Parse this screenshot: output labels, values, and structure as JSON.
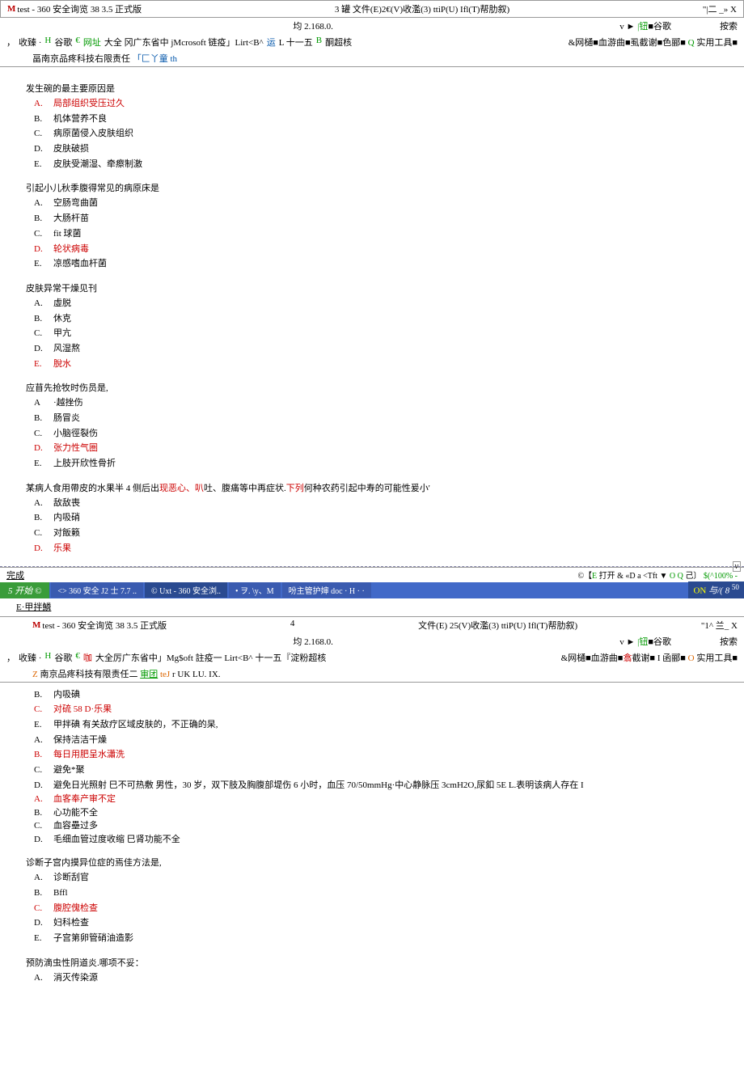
{
  "window1": {
    "title_prefix": "M",
    "title": "test - 360 安全询览 38 3.5 正式版",
    "menu_right": "3 罐 文件(E)2€(V)收濫(3) ttiP(U) Ifl(T)帮肋叙)",
    "win_controls": "\"|二 _» X",
    "addr_center": "均 2.168.0.",
    "addr_right_v": "v ►",
    "addr_right_bar": "|钮",
    "addr_right_gu": "■谷歌",
    "addr_search": "按索",
    "bookmarks": {
      "comma": "，",
      "fav": "收臻 ·",
      "h": "H",
      "gu": "谷歌",
      "euro": "€",
      "wangzhi": "网址",
      "daquan": "大全 冈广东省中 jMcrosoft 链疫」Lirt<B^",
      "yun": "运",
      "ls": "L 十一五",
      "b": "B",
      "tong": "酮超核",
      "right": "&网樋■血游曲■虱截谢■色郦■",
      "q": "Q",
      "tools": "实用工具■"
    },
    "subtitle_prefix": "畐南京品疼科技右限责任",
    "subtitle_blue": "「匚丫童 th"
  },
  "content1": {
    "questions": [
      {
        "q": "发生碗的最主要原因是",
        "opts": [
          {
            "l": "A.",
            "t": "局部组织受压过久",
            "red": true
          },
          {
            "l": "B.",
            "t": "机体营养不良"
          },
          {
            "l": "C.",
            "t": "病原菌侵入皮肤组织"
          },
          {
            "l": "D.",
            "t": "皮肤破损"
          },
          {
            "l": "E.",
            "t": "皮肤受潮湿、牵瘵制激"
          }
        ]
      },
      {
        "q": "引起小儿秋季腹得常见的病原床是",
        "opts": [
          {
            "l": "A.",
            "t": "空肠弯曲菌"
          },
          {
            "l": "B.",
            "t": "大肠杆苗"
          },
          {
            "l": "C.",
            "t": "fit 球菌"
          },
          {
            "l": "D.",
            "t": "轮状病毒",
            "red": true
          },
          {
            "l": "E.",
            "t": "凉感嗜血杆菌"
          }
        ]
      },
      {
        "q": "皮肤异常干燥见刊",
        "opts": [
          {
            "l": "A.",
            "t": "虛脱"
          },
          {
            "l": "B.",
            "t": "休克"
          },
          {
            "l": "C.",
            "t": "甲亢"
          },
          {
            "l": "D.",
            "t": "风湿熬"
          },
          {
            "l": "E.",
            "t": "脫水",
            "red": true
          }
        ]
      },
      {
        "q": "应苜先抢牧时伤员是,",
        "opts": [
          {
            "l": "A",
            "t": "·越挫伤"
          },
          {
            "l": "B.",
            "t": "肠冒炎"
          },
          {
            "l": "C.",
            "t": "小脑徑裂伤"
          },
          {
            "l": "D.",
            "t": "张力性气圏",
            "red": true
          },
          {
            "l": "E.",
            "t": "上肢开欣性骨折"
          }
        ]
      },
      {
        "q_parts": [
          "某病人食用帶皮的水果半 4 侧后出",
          "现恶心、叭",
          "吐、腹痛等中再症状.",
          "下列",
          "何种农药引起中寿的可能性爰小'"
        ],
        "q_red_idx": [
          1,
          3
        ],
        "opts": [
          {
            "l": "A.",
            "t": "敌敌喪"
          },
          {
            "l": "B.",
            "t": "内吸硝"
          },
          {
            "l": "C.",
            "t": "对飯籁"
          },
          {
            "l": "D.",
            "t": "乐果",
            "red": true
          }
        ]
      }
    ]
  },
  "status1": {
    "left": "完成",
    "right_prefix": "©【",
    "right_e": "E",
    "right_mid": "打开 & «D a <Tft ▼",
    "right_oq": "O Q",
    "right_ji": "己〕",
    "right_pct": "$(^100% -",
    "scroll": "v"
  },
  "taskbar": {
    "start": "5 开始 ©",
    "items": [
      "<> 360 安全 J2 士 7.7 ..",
      "© Uxt - 360 安全浏..",
      "• ヲ. \\y、M",
      "吩主管护婶 doc · H · ·"
    ],
    "tray_on": "ON",
    "tray_rest": "与/( 8 ",
    "tray_sup": "50"
  },
  "extra_line": "E·甲拌鱗",
  "window2": {
    "title_prefix": "M",
    "title": "test - 360 安全询览 38 3.5 正式版",
    "menu_center": "4",
    "menu_right": "文件(E) 25(V)收濫(3) ttiP(U) Ifl(T)帮肋叙)",
    "win_controls": "\"1^ 兰_ X",
    "addr_center": "均 2.168.0.",
    "addr_right_v": "v ►",
    "addr_right_bar": "|钮",
    "addr_right_gu": "■谷歌",
    "addr_search": "按索",
    "bookmarks": {
      "comma": "，",
      "fav": "收臻 ·",
      "h": "H",
      "gu": "谷歌",
      "euro": "€",
      "ka": "咖",
      "daquan": "大全厉广东省中」Mg$oft 註疫一 Lirt<B^ 十一五『淀粉超核",
      "right_prefix": "&网樋■血游曲■",
      "chong": "翕",
      "right_mid": "截谢■ I 函郦■",
      "o": "O",
      "tools": "实用工具■"
    },
    "subtitle_z": "Z",
    "subtitle_main": "南京品疼科技有限责任二",
    "subtitle_green": "审团",
    "subtitle_te": "teJ",
    "subtitle_rest": "r UK LU. IX."
  },
  "content2": {
    "pre_opts": [
      {
        "l": "B.",
        "t": "内吸碘"
      },
      {
        "l": "C.",
        "t": "对硫 58 D·乐果",
        "red": true
      },
      {
        "l": "E.",
        "t": "甲拌碘 有关敌疗区域皮肤的，不正确的杲,"
      },
      {
        "l": "A.",
        "t": "保持洁洁干燥"
      },
      {
        "l": "B.",
        "t": "每日用肥呈水瀟洗",
        "red": true
      },
      {
        "l": "C.",
        "t": "避免*聚"
      },
      {
        "l": "D.",
        "t": "避免日光照射 巳不可热敷 男性，30 岁，双下肢及胸腹部堤伤 6 小时，血压 70/50mmHg·中心静脉压 3cmH2O,尿釦 5E L.表明该病人存在 I"
      },
      {
        "l": "A.",
        "t": "血客奉产审不定",
        "red": true,
        "tight": true
      },
      {
        "l": "B.",
        "t": "心功能不全",
        "tight": true
      },
      {
        "l": "C.",
        "t": "血容壘过多",
        "tight": true
      },
      {
        "l": "D.",
        "t": "毛细血管过度收缩 巳肾功能不全",
        "tight": true
      }
    ],
    "questions": [
      {
        "q": "诊断子宫内摸异位症的焉佳方法是,",
        "opts": [
          {
            "l": "A.",
            "t": "诊断刮官"
          },
          {
            "l": "B.",
            "t": "Bffl"
          },
          {
            "l": "C.",
            "t": "腹腔傀检查",
            "red": true
          },
          {
            "l": "D.",
            "t": "妇科检查"
          },
          {
            "l": "E.",
            "t": "子宫第卵管硝油造影"
          }
        ]
      },
      {
        "q": "预防滴虫性阴道炎.哪项不妥：",
        "opts": [
          {
            "l": "A.",
            "t": "消灭传染源"
          }
        ]
      }
    ]
  }
}
